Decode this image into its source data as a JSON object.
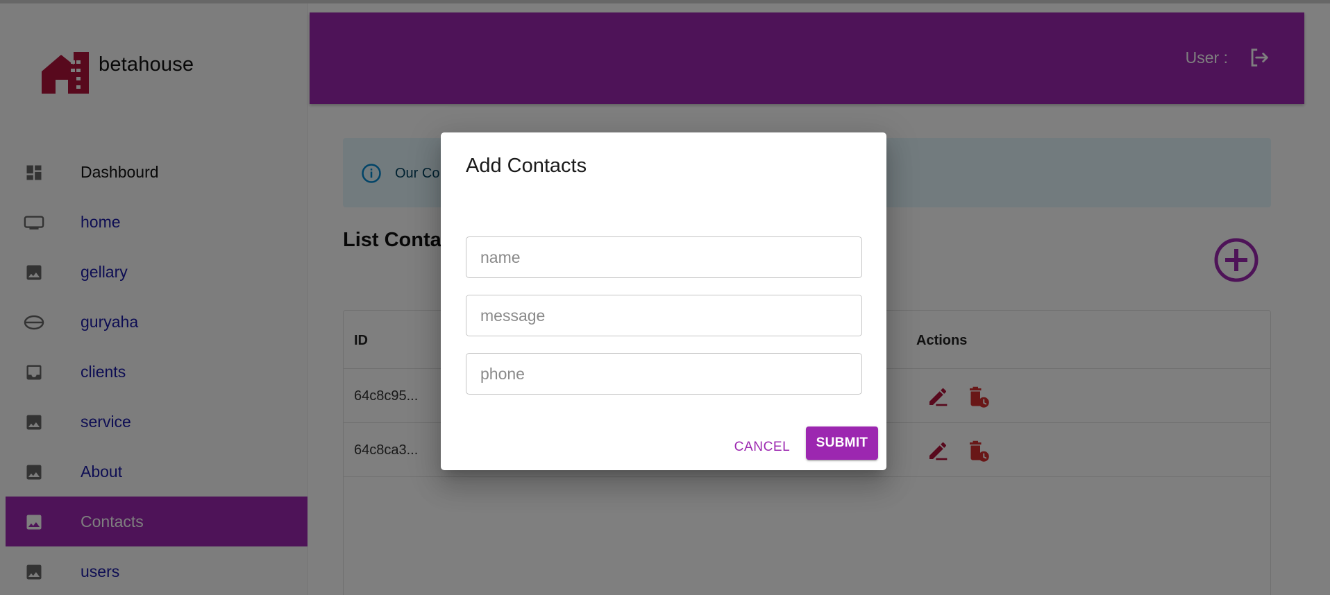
{
  "brand": {
    "name": "betahouse",
    "logo_icon": "house-logo-icon",
    "color": "#b0123a"
  },
  "sidebar": {
    "items": [
      {
        "label": "Dashbourd",
        "icon": "dashboard-icon"
      },
      {
        "label": "home",
        "icon": "tv-icon"
      },
      {
        "label": "gellary",
        "icon": "image-icon"
      },
      {
        "label": "guryaha",
        "icon": "lens-icon"
      },
      {
        "label": "clients",
        "icon": "inbox-icon"
      },
      {
        "label": "service",
        "icon": "image-icon"
      },
      {
        "label": "About",
        "icon": "image-icon"
      },
      {
        "label": "Contacts",
        "icon": "image-icon",
        "active": true
      },
      {
        "label": "users",
        "icon": "image-icon"
      }
    ]
  },
  "header": {
    "user_label": "User :",
    "logout_icon": "logout-icon"
  },
  "alert": {
    "text": "Our Co",
    "icon": "info-icon"
  },
  "main": {
    "list_title": "List Conta",
    "add_icon": "add-circle-icon"
  },
  "table": {
    "headers": {
      "id": "ID",
      "actions": "Actions"
    },
    "rows": [
      {
        "id": "64c8c95..."
      },
      {
        "id": "64c8ca3..."
      }
    ],
    "edit_icon": "edit-icon",
    "delete_icon": "delete-clock-icon"
  },
  "dialog": {
    "title": "Add Contacts",
    "fields": {
      "name": {
        "placeholder": "name",
        "value": ""
      },
      "message": {
        "placeholder": "message",
        "value": ""
      },
      "phone": {
        "placeholder": "phone",
        "value": ""
      }
    },
    "cancel_label": "CANCEL",
    "submit_label": "SUBMIT"
  },
  "colors": {
    "primary": "#9c27b0",
    "action_red": "#d32f2f",
    "edit_red": "#b0123a",
    "nav_link": "#1a1aa6",
    "alert_bg": "#e5f6fd",
    "info_blue": "#0288d1"
  }
}
